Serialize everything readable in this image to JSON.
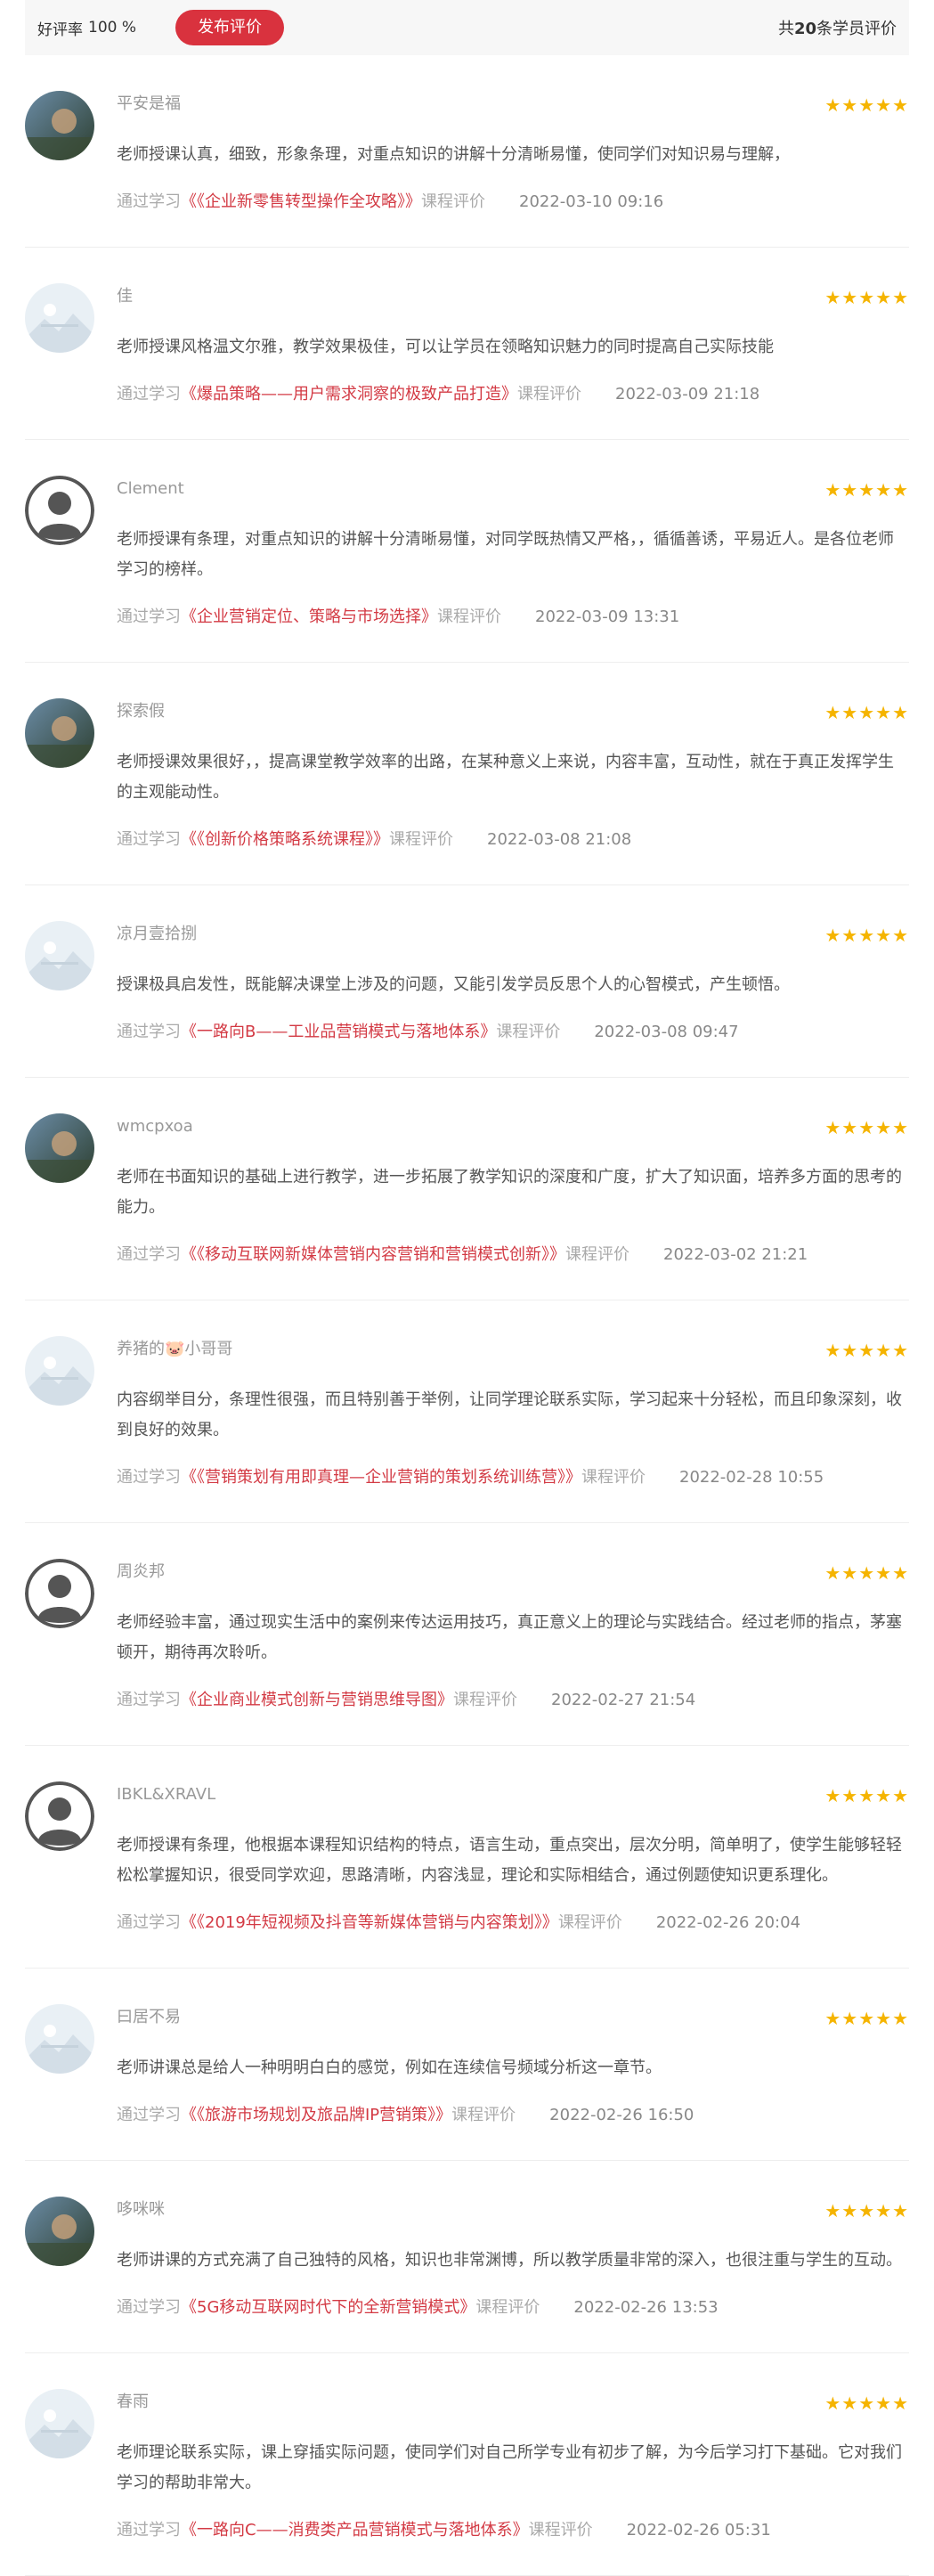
{
  "summary": {
    "rate_label": "好评率",
    "rate_value": "100 %",
    "publish_button": "发布评价",
    "total_prefix": "共",
    "total_count": "20",
    "total_suffix": "条学员评价"
  },
  "review_labels": {
    "via_prefix": "通过学习",
    "via_suffix": "课程评价",
    "stars": "★★★★★"
  },
  "colors": {
    "accent": "#d9323e",
    "star": "#f5b400"
  },
  "reviews": [
    {
      "user": "平安是福",
      "avatar": "photo-avatar",
      "content": "老师授课认真，细致，形象条理，对重点知识的讲解十分清晰易懂，使同学们对知识易与理解，",
      "course": "《《企业新零售转型操作全攻略》》",
      "date": "2022-03-10 09:16"
    },
    {
      "user": "佳",
      "avatar": "default-avatar",
      "content": "老师授课风格温文尔雅，教学效果极佳，可以让学员在领略知识魅力的同时提高自己实际技能",
      "course": "《爆品策略——用户需求洞察的极致产品打造》",
      "date": "2022-03-09 21:18"
    },
    {
      "user": "Clement",
      "avatar": "person-silhouette-avatar",
      "content": "老师授课有条理，对重点知识的讲解十分清晰易懂，对同学既热情又严格，，循循善诱，平易近人。是各位老师学习的榜样。",
      "course": "《企业营销定位、策略与市场选择》",
      "date": "2022-03-09 13:31"
    },
    {
      "user": "探索假",
      "avatar": "photo-avatar",
      "content": "老师授课效果很好，，提高课堂教学效率的出路，在某种意义上来说，内容丰富，互动性，就在于真正发挥学生的主观能动性。",
      "course": "《《创新价格策略系统课程》》",
      "date": "2022-03-08 21:08"
    },
    {
      "user": "凉月壹拾捌",
      "avatar": "default-avatar",
      "content": "授课极具启发性，既能解决课堂上涉及的问题，又能引发学员反思个人的心智模式，产生顿悟。",
      "course": "《一路向B——工业品营销模式与落地体系》",
      "date": "2022-03-08 09:47"
    },
    {
      "user": "wmcpxoa",
      "avatar": "photo-avatar",
      "content": "老师在书面知识的基础上进行教学，进一步拓展了教学知识的深度和广度，扩大了知识面，培养多方面的思考的能力。",
      "course": "《《移动互联网新媒体营销内容营销和营销模式创新》》",
      "date": "2022-03-02 21:21"
    },
    {
      "user": "养猪的🐷小哥哥",
      "avatar": "default-avatar",
      "content": "内容纲举目分，条理性很强，而且特别善于举例，让同学理论联系实际，学习起来十分轻松，而且印象深刻，收到良好的效果。",
      "course": "《《营销策划有用即真理—企业营销的策划系统训练营》》",
      "date": "2022-02-28 10:55"
    },
    {
      "user": "周炎邦",
      "avatar": "person-silhouette-avatar",
      "content": "老师经验丰富，通过现实生活中的案例来传达运用技巧，真正意义上的理论与实践结合。经过老师的指点，茅塞顿开，期待再次聆听。",
      "course": "《企业商业模式创新与营销思维导图》",
      "date": "2022-02-27 21:54"
    },
    {
      "user": "IBKL&XRAVL",
      "avatar": "person-silhouette-avatar",
      "content": "老师授课有条理，他根据本课程知识结构的特点，语言生动，重点突出，层次分明，简单明了，使学生能够轻轻松松掌握知识，很受同学欢迎，思路清晰，内容浅显，理论和实际相结合，通过例题使知识更系理化。",
      "course": "《《2019年短视频及抖音等新媒体营销与内容策划》》",
      "date": "2022-02-26 20:04"
    },
    {
      "user": "曰居不易",
      "avatar": "default-avatar",
      "content": "老师讲课总是给人一种明明白白的感觉，例如在连续信号频域分析这一章节。",
      "course": "《《旅游市场规划及旅品牌IP营销策》》",
      "date": "2022-02-26 16:50"
    },
    {
      "user": "哆咪咪",
      "avatar": "photo-avatar",
      "content": "老师讲课的方式充满了自己独特的风格，知识也非常渊博，所以教学质量非常的深入，也很注重与学生的互动。",
      "course": "《5G移动互联网时代下的全新营销模式》",
      "date": "2022-02-26 13:53"
    },
    {
      "user": "春雨",
      "avatar": "default-avatar",
      "content": "老师理论联系实际，课上穿插实际问题，使同学们对自己所学专业有初步了解，为今后学习打下基础。它对我们学习的帮助非常大。",
      "course": "《一路向C——消费类产品营销模式与落地体系》",
      "date": "2022-02-26 05:31"
    }
  ]
}
